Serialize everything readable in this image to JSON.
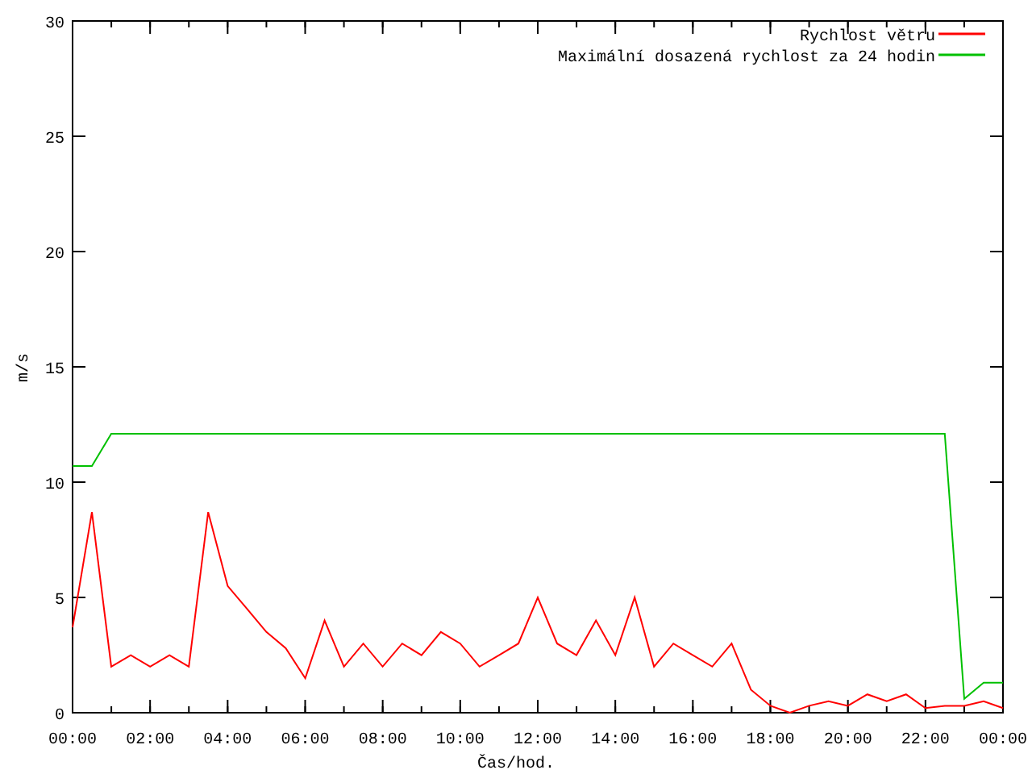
{
  "chart_data": {
    "type": "line",
    "xlabel": "Čas/hod.",
    "ylabel": "m/s",
    "x": [
      0,
      0.5,
      1,
      1.5,
      2,
      2.5,
      3,
      3.5,
      4,
      4.5,
      5,
      5.5,
      6,
      6.5,
      7,
      7.5,
      8,
      8.5,
      9,
      9.5,
      10,
      10.5,
      11,
      11.5,
      12,
      12.5,
      13,
      13.5,
      14,
      14.5,
      15,
      15.5,
      16,
      16.5,
      17,
      17.5,
      18,
      18.5,
      19,
      19.5,
      20,
      20.5,
      21,
      21.5,
      22,
      22.5,
      23,
      23.5,
      24
    ],
    "series": [
      {
        "name": "Rychlost větru",
        "color": "#ff0000",
        "values": [
          3.7,
          8.7,
          2.0,
          2.5,
          2.0,
          2.5,
          2.0,
          8.7,
          5.5,
          4.5,
          3.5,
          2.8,
          1.5,
          4.0,
          2.0,
          3.0,
          2.0,
          3.0,
          2.5,
          3.5,
          3.0,
          2.0,
          2.5,
          3.0,
          5.0,
          3.0,
          2.5,
          4.0,
          2.5,
          5.0,
          2.0,
          3.0,
          2.5,
          2.0,
          3.0,
          1.0,
          0.3,
          0,
          0.3,
          0.5,
          0.3,
          0.8,
          0.5,
          0.8,
          0.2,
          0.3,
          0.3,
          0.5,
          0.2
        ]
      },
      {
        "name": "Maximální dosazená rychlost za 24 hodin",
        "color": "#00c000",
        "values": [
          10.7,
          10.7,
          12.1,
          12.1,
          12.1,
          12.1,
          12.1,
          12.1,
          12.1,
          12.1,
          12.1,
          12.1,
          12.1,
          12.1,
          12.1,
          12.1,
          12.1,
          12.1,
          12.1,
          12.1,
          12.1,
          12.1,
          12.1,
          12.1,
          12.1,
          12.1,
          12.1,
          12.1,
          12.1,
          12.1,
          12.1,
          12.1,
          12.1,
          12.1,
          12.1,
          12.1,
          12.1,
          12.1,
          12.1,
          12.1,
          12.1,
          12.1,
          12.1,
          12.1,
          12.1,
          12.1,
          0.6,
          1.3,
          1.3
        ]
      }
    ],
    "legend": "top-right",
    "xlim": [
      0,
      24
    ],
    "ylim": [
      0,
      30
    ],
    "xticks": [
      {
        "value": 0,
        "label": "00:00"
      },
      {
        "value": 2,
        "label": "02:00"
      },
      {
        "value": 4,
        "label": "04:00"
      },
      {
        "value": 6,
        "label": "06:00"
      },
      {
        "value": 8,
        "label": "08:00"
      },
      {
        "value": 10,
        "label": "10:00"
      },
      {
        "value": 12,
        "label": "12:00"
      },
      {
        "value": 14,
        "label": "14:00"
      },
      {
        "value": 16,
        "label": "16:00"
      },
      {
        "value": 18,
        "label": "18:00"
      },
      {
        "value": 20,
        "label": "20:00"
      },
      {
        "value": 22,
        "label": "22:00"
      },
      {
        "value": 24,
        "label": "00:00"
      }
    ],
    "yticks": [
      0,
      5,
      10,
      15,
      20,
      25,
      30
    ]
  }
}
